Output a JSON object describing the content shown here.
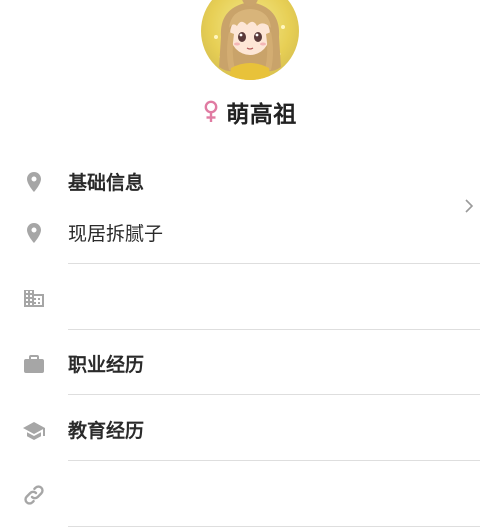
{
  "profile": {
    "name": "萌高祖",
    "gender_icon": "female-symbol-icon",
    "gender_color": "#e07ba2",
    "avatar": "anime-girl-avatar"
  },
  "sections": {
    "basic_info_label": "基础信息",
    "residence_label": "现居拆腻子",
    "company_label": "",
    "career_label": "职业经历",
    "education_label": "教育经历",
    "link_label": ""
  },
  "icons": {
    "location": "location-pin-icon",
    "company": "building-icon",
    "career": "briefcase-icon",
    "education": "graduation-cap-icon",
    "link": "link-icon",
    "chevron": "chevron-right-icon"
  },
  "colors": {
    "icon_gray": "#a6a6a6",
    "divider": "#dedede",
    "text": "#2a2a2a"
  }
}
